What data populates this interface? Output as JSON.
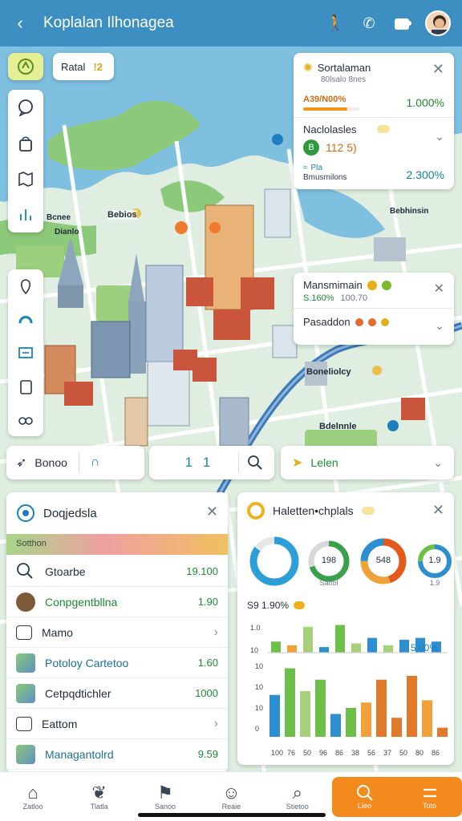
{
  "header": {
    "back_icon": "chevron-left-icon",
    "title": "Koplalan Ilhonagea",
    "icons": [
      "walk-icon",
      "phone-icon",
      "puzzle-icon",
      "avatar"
    ],
    "bg_color": "#3d8fc1"
  },
  "map_controls": {
    "top_chip_label": "Ratal",
    "top_chip_badge": "!2",
    "left_tools": [
      "bubble-icon",
      "bag-icon",
      "map-fold-icon",
      "bars-icon"
    ],
    "left_tools_2": [
      "pin-icon",
      "route-icon",
      "layers-icon",
      "clipboard-icon",
      "binoculars-icon"
    ]
  },
  "map_labels": [
    {
      "text": "Bebios"
    },
    {
      "text": "Bcnee"
    },
    {
      "text": "Dianlo"
    },
    {
      "text": "Bebhinsin"
    },
    {
      "text": "Boneliolcy"
    },
    {
      "text": "Bdelnnle"
    }
  ],
  "info_cards": {
    "card1": {
      "title": "Sortalaman",
      "subtitle": "80lsalo 8nes",
      "progress_label": "A39/N00%",
      "value": "1.000%"
    },
    "card2": {
      "title": "Naclolasles",
      "badge_value": "112 5)",
      "small_label": "Pla",
      "small_sub": "Bmusmilons",
      "value": "2.300%"
    },
    "card3": {
      "title": "Mansmimain",
      "subtitle": "S.160%",
      "subtitle2": "100.70"
    },
    "card4": {
      "title": "Pasaddon"
    }
  },
  "search_row": {
    "left_label": "Bonoo",
    "mid_value": "1 1",
    "right_label": "Lelen"
  },
  "left_panel": {
    "title": "Doqjedsla",
    "banner": "Sotthon",
    "rows": [
      {
        "label": "Gtoarbe",
        "value": "19.100",
        "icon": "search-icon"
      },
      {
        "label": "Conpgentbllna",
        "value": "1.90",
        "icon": "avatar"
      },
      {
        "label": "Mamo",
        "value": "",
        "icon": "box-icon"
      },
      {
        "label": "Potoloy Cartetoo",
        "value": "1.60",
        "icon": "map-thumb-icon"
      },
      {
        "label": "Cetpqdtichler",
        "value": "1000",
        "icon": "map-thumb-icon"
      },
      {
        "label": "Eattom",
        "value": "",
        "icon": "box-icon"
      },
      {
        "label": "Managantolrd",
        "value": "9.59",
        "icon": "map-thumb-icon"
      }
    ]
  },
  "right_panel": {
    "title": "Haletten•chplals",
    "donuts": [
      {
        "label": ""
      },
      {
        "label": "198",
        "sub": "Sattol"
      },
      {
        "label": "548",
        "sub": ""
      },
      {
        "label": "1.9",
        "sub": "1.9"
      }
    ],
    "stat_label": "S9 1.90%",
    "bar_annotation": "5.00%",
    "yaxis_top": [
      "1.0",
      "10"
    ],
    "yaxis_bottom": [
      "10",
      "10",
      "10",
      "0"
    ],
    "xticks": [
      "100",
      "76",
      "50",
      "96",
      "86",
      "38",
      "56",
      "37",
      "50",
      "80",
      "86"
    ]
  },
  "chart_data": [
    {
      "type": "donut",
      "slices": [
        {
          "name": "a",
          "values": [
            0.85,
            0.15
          ]
        }
      ],
      "colors": [
        "#2d9fd8",
        "#e6e6e6"
      ]
    },
    {
      "type": "bar",
      "categories": [
        "1",
        "2",
        "3",
        "4",
        "5",
        "6",
        "7",
        "8",
        "9",
        "10",
        "11"
      ],
      "series": [
        {
          "values": [
            0.3,
            0.2,
            0.7,
            0.15,
            0.75,
            0.25,
            0.4,
            0.2,
            0.35,
            0.4,
            0.3
          ]
        }
      ],
      "colors": [
        "#6cc04a",
        "#f0a13a",
        "#a6d07a",
        "#2d8fd0",
        "#6cc04a",
        "#a6d07a",
        "#2d8fd0",
        "#a6d07a",
        "#2d8fd0",
        "#2d8fd0",
        "#2d8fd0"
      ]
    },
    {
      "type": "bar",
      "categories": [
        "100",
        "76",
        "50",
        "96",
        "86",
        "38",
        "56",
        "37",
        "50",
        "80",
        "86"
      ],
      "series": [
        {
          "values": [
            0.55,
            0.9,
            0.6,
            0.75,
            0.3,
            0.38,
            0.45,
            0.75,
            0.25,
            0.8,
            0.48,
            0.12
          ]
        }
      ],
      "colors": [
        "#2d8fd0",
        "#6cc04a",
        "#a6d07a",
        "#6cc04a",
        "#2d8fd0",
        "#6cc04a",
        "#f0a13a",
        "#e07a2a",
        "#e07a2a",
        "#e07a2a",
        "#f0a13a",
        "#e07a2a"
      ]
    }
  ],
  "bottom_nav": {
    "items": [
      {
        "label": "Zatloo",
        "icon": "home-icon"
      },
      {
        "label": "Tlatla",
        "icon": "leaf-icon"
      },
      {
        "label": "Sanoo",
        "icon": "flag-icon"
      },
      {
        "label": "Reaie",
        "icon": "face-icon"
      },
      {
        "label": "Stietoo",
        "icon": "map-search-icon"
      }
    ],
    "action_left_label": "Lleo",
    "action_right_label": "Toto",
    "accent": "#f28a1e"
  }
}
